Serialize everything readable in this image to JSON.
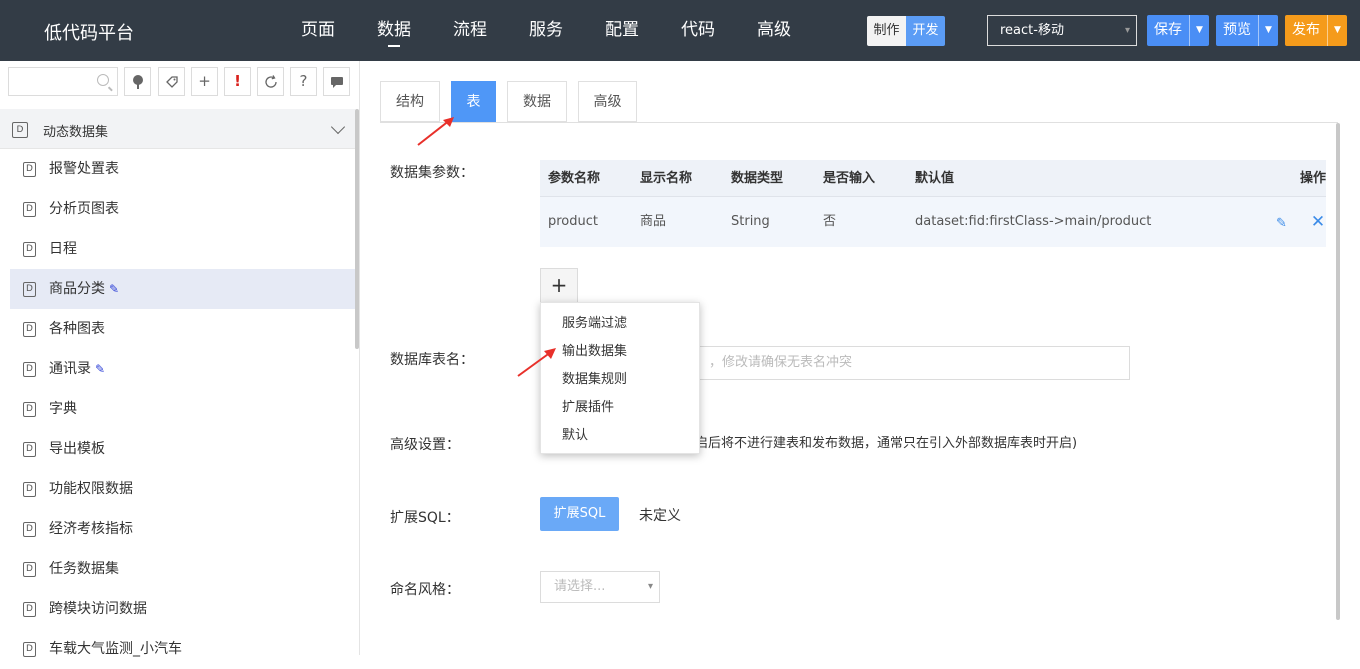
{
  "app": {
    "title": "低代码平台"
  },
  "nav": [
    "页面",
    "数据",
    "流程",
    "服务",
    "配置",
    "代码",
    "高级"
  ],
  "mode": {
    "make": "制作",
    "dev": "开发"
  },
  "project": {
    "value": "react-移动"
  },
  "toolbar": {
    "save": "保存",
    "preview": "预览",
    "publish": "发布"
  },
  "sidebar": {
    "search_placeholder": "",
    "group": "动态数据集",
    "items": [
      {
        "label": "报警处置表",
        "edited": false
      },
      {
        "label": "分析页图表",
        "edited": false
      },
      {
        "label": "日程",
        "edited": false
      },
      {
        "label": "商品分类",
        "edited": true,
        "selected": true
      },
      {
        "label": "各种图表",
        "edited": false
      },
      {
        "label": "通讯录",
        "edited": true
      },
      {
        "label": "字典",
        "edited": false
      },
      {
        "label": "导出模板",
        "edited": false
      },
      {
        "label": "功能权限数据",
        "edited": false
      },
      {
        "label": "经济考核指标",
        "edited": false
      },
      {
        "label": "任务数据集",
        "edited": false
      },
      {
        "label": "跨模块访问数据",
        "edited": false
      },
      {
        "label": "车载大气监测_小汽车",
        "edited": false
      }
    ]
  },
  "tabs": [
    {
      "label": "结构",
      "active": false
    },
    {
      "label": "表",
      "active": true
    },
    {
      "label": "数据",
      "active": false
    },
    {
      "label": "高级",
      "active": false
    }
  ],
  "form": {
    "params_label": "数据集参数：",
    "table_name_label": "数据库表名：",
    "table_name_hint": "，修改请确保无表名冲突",
    "advanced_label": "高级设置：",
    "advanced_text": "启后将不进行建表和发布数据，通常只在引入外部数据库表时开启)",
    "sql_label": "扩展SQL：",
    "sql_button": "扩展SQL",
    "sql_value": "未定义",
    "naming_label": "命名风格：",
    "naming_placeholder": "请选择..."
  },
  "params_table": {
    "headers": [
      "参数名称",
      "显示名称",
      "数据类型",
      "是否输入",
      "默认值",
      "操作"
    ],
    "rows": [
      [
        "product",
        "商品",
        "String",
        "否",
        "dataset:fid:firstClass->main/product"
      ]
    ]
  },
  "add_menu": [
    "服务端过滤",
    "输出数据集",
    "数据集规则",
    "扩展插件",
    "默认"
  ],
  "colors": {
    "topbar": "#333c46",
    "accent": "#4f97f7",
    "publish": "#f59b1b",
    "arrow": "#e8302a"
  }
}
